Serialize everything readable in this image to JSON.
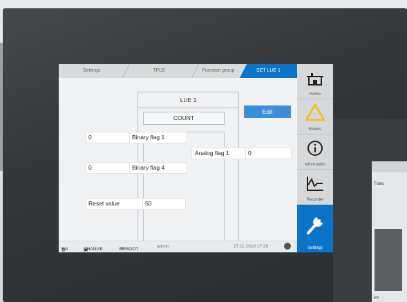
{
  "tabs": [
    "Settings",
    "TPLE",
    "Function group",
    "SET LUE 1"
  ],
  "panel": {
    "title": "LUE 1",
    "subtitle": "COUNT"
  },
  "edit_label": "Edit",
  "inputs": [
    {
      "value": "0",
      "label": "Binary flag 1"
    },
    {
      "value": "0",
      "label": "Binary flag 4"
    }
  ],
  "analog": {
    "label": "Analog flag 1",
    "value": "0"
  },
  "reset": {
    "label": "Reset value",
    "value": "50"
  },
  "sidebar": [
    {
      "label": "Home",
      "icon": "home-icon"
    },
    {
      "label": "Events",
      "icon": "warning-icon"
    },
    {
      "label": "Information",
      "icon": "info-icon"
    },
    {
      "label": "Recorder",
      "icon": "recorder-icon"
    },
    {
      "label": "Settings",
      "icon": "wrench-icon"
    }
  ],
  "status": {
    "lang": "EN",
    "change": "CHANGE",
    "reboot": "REBOOT",
    "user": "admin",
    "datetime": "27.11.2018 17:29"
  },
  "second_device": {
    "title": "Trans",
    "status": "EN"
  },
  "colors": {
    "accent": "#0a74c9",
    "warning": "#f4c21f"
  }
}
